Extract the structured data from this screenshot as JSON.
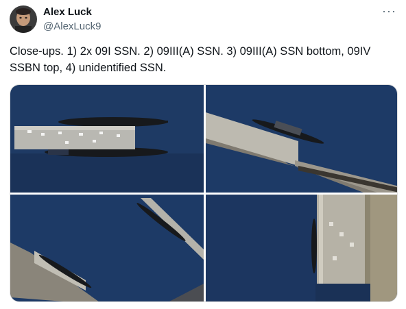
{
  "author": {
    "name": "Alex Luck",
    "handle": "@AlexLuck9"
  },
  "menu_icon": "more-horizontal-icon",
  "tweet_text": "Close-ups. 1) 2x 09I SSN. 2) 09III(A) SSN. 3) 09III(A) SSN bottom, 09IV SSBN top, 4) unidentified SSN.",
  "colors": {
    "water": "#1f3a63",
    "water_dark": "#172f52",
    "pier": "#b8b6ad",
    "breakwater": "#8f8b82",
    "sub": "#1b1e22",
    "land": "#a59b85"
  },
  "images": [
    {
      "subject": "2x 09I SSN alongside pier"
    },
    {
      "subject": "09III(A) SSN at pier end"
    },
    {
      "subject": "09III(A) SSN bottom, 09IV SSBN top"
    },
    {
      "subject": "unidentified SSN"
    }
  ]
}
